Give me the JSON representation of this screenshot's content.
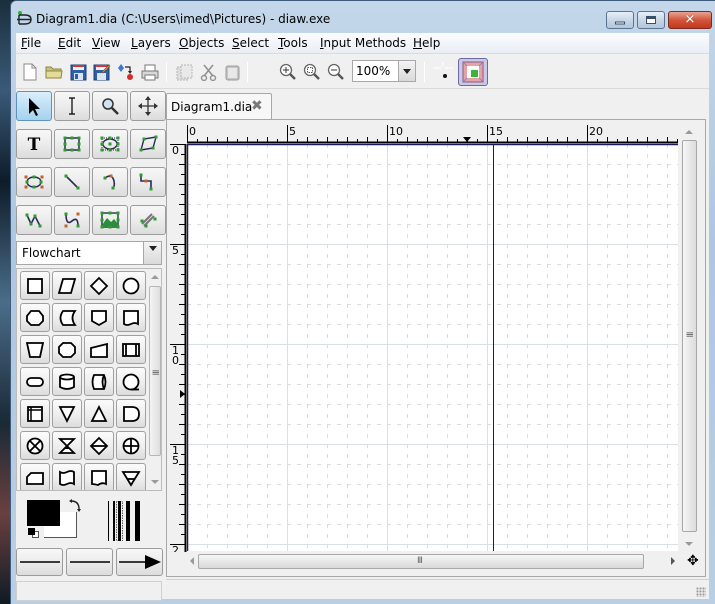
{
  "window": {
    "title": "Diagram1.dia (C:\\Users\\imed\\Pictures) - diaw.exe",
    "controls": {
      "minimize": "minimize",
      "maximize": "maximize",
      "close": "close"
    }
  },
  "menubar": {
    "items": [
      {
        "label": "File",
        "accel": "F"
      },
      {
        "label": "Edit",
        "accel": "E"
      },
      {
        "label": "View",
        "accel": "V"
      },
      {
        "label": "Layers",
        "accel": "L"
      },
      {
        "label": "Objects",
        "accel": "O"
      },
      {
        "label": "Select",
        "accel": "S"
      },
      {
        "label": "Tools",
        "accel": "T"
      },
      {
        "label": "Input Methods",
        "accel": "I"
      },
      {
        "label": "Help",
        "accel": "H"
      }
    ]
  },
  "toolbar": {
    "buttons": [
      "new-file",
      "open-file",
      "save",
      "save-as",
      "export",
      "print",
      "copy",
      "cut",
      "paste",
      "zoom-in",
      "zoom-fit",
      "zoom-out"
    ],
    "zoom_value": "100%",
    "snap_to_grid": false,
    "snap_to_objects": true
  },
  "toolbox": {
    "tools": [
      "modify",
      "text-edit",
      "magnify",
      "scroll",
      "text",
      "box",
      "ellipse",
      "polygon",
      "beziergon",
      "line",
      "arc",
      "zigzag-line",
      "polyline",
      "bezier-line",
      "image",
      "outline"
    ],
    "active_tool": "modify",
    "sheet": "Flowchart",
    "shapes": [
      "process",
      "data",
      "decision",
      "connector",
      "preparation",
      "stored-data",
      "offpage-connector",
      "document",
      "manual-operation",
      "display",
      "manual-input",
      "predefined-process",
      "terminal",
      "magnetic-disk",
      "direct-access-storage",
      "sequential-data",
      "internal-storage",
      "merge",
      "extract",
      "delay",
      "summing-junction",
      "collate",
      "sort",
      "or",
      "card",
      "punched-tape",
      "transmittal-tape",
      "offline-storage"
    ],
    "colors": {
      "foreground": "#000000",
      "background": "#ffffff"
    }
  },
  "document": {
    "tab_label": "Diagram1.dia",
    "h_ruler_labels": [
      "0",
      "5",
      "10",
      "15",
      "20"
    ],
    "v_ruler_labels": [
      "0",
      "5",
      "1\n0",
      "1\n5",
      "2"
    ],
    "h_ruler_marker": 14,
    "v_ruler_marker": 12.5,
    "page_break_x": 15.3
  },
  "colors": {
    "grid_minor": "#dcdcdc",
    "grid_major": "#d7e0e2",
    "page_border": "#1a1a5c"
  }
}
